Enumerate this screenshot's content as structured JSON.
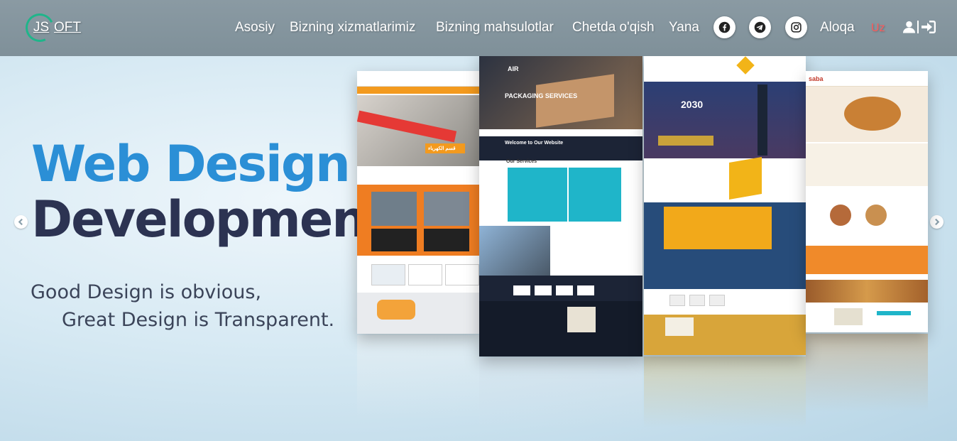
{
  "brand": {
    "logo_left": "JS",
    "logo_right": "OFT"
  },
  "nav": {
    "items": [
      "Asosiy",
      "Bizning xizmatlarimiz",
      "Bizning mahsulotlar",
      "Chetda o'qish",
      "Yana",
      "Aloqa"
    ],
    "language": "Uz",
    "social_icons": [
      "facebook-icon",
      "telegram-icon",
      "instagram-icon"
    ],
    "login_icon": "user-login-icon"
  },
  "hero": {
    "headline_part1": "Web Design",
    "headline_amp": "&",
    "headline_part2": "Development",
    "tagline_line1": "Good Design is obvious,",
    "tagline_line2": "Great Design is Transparent."
  },
  "mockups": {
    "panel1_label": "قسم الكهرباء",
    "panel2_banner": "PACKAGING SERVICES",
    "panel2_welcome": "Welcome to Our Website",
    "panel2_services": "Our Services",
    "panel3_year": "2030",
    "panel4_brand": "saba"
  },
  "colors": {
    "nav_bg": "#849499",
    "headline_blue": "#2b8fd6",
    "headline_green": "#8bc34a",
    "headline_dark": "#2c3352",
    "accent_orange": "#f39a1e",
    "accent_cyan": "#1fb5c9",
    "lang_red": "#ff5a5a"
  }
}
